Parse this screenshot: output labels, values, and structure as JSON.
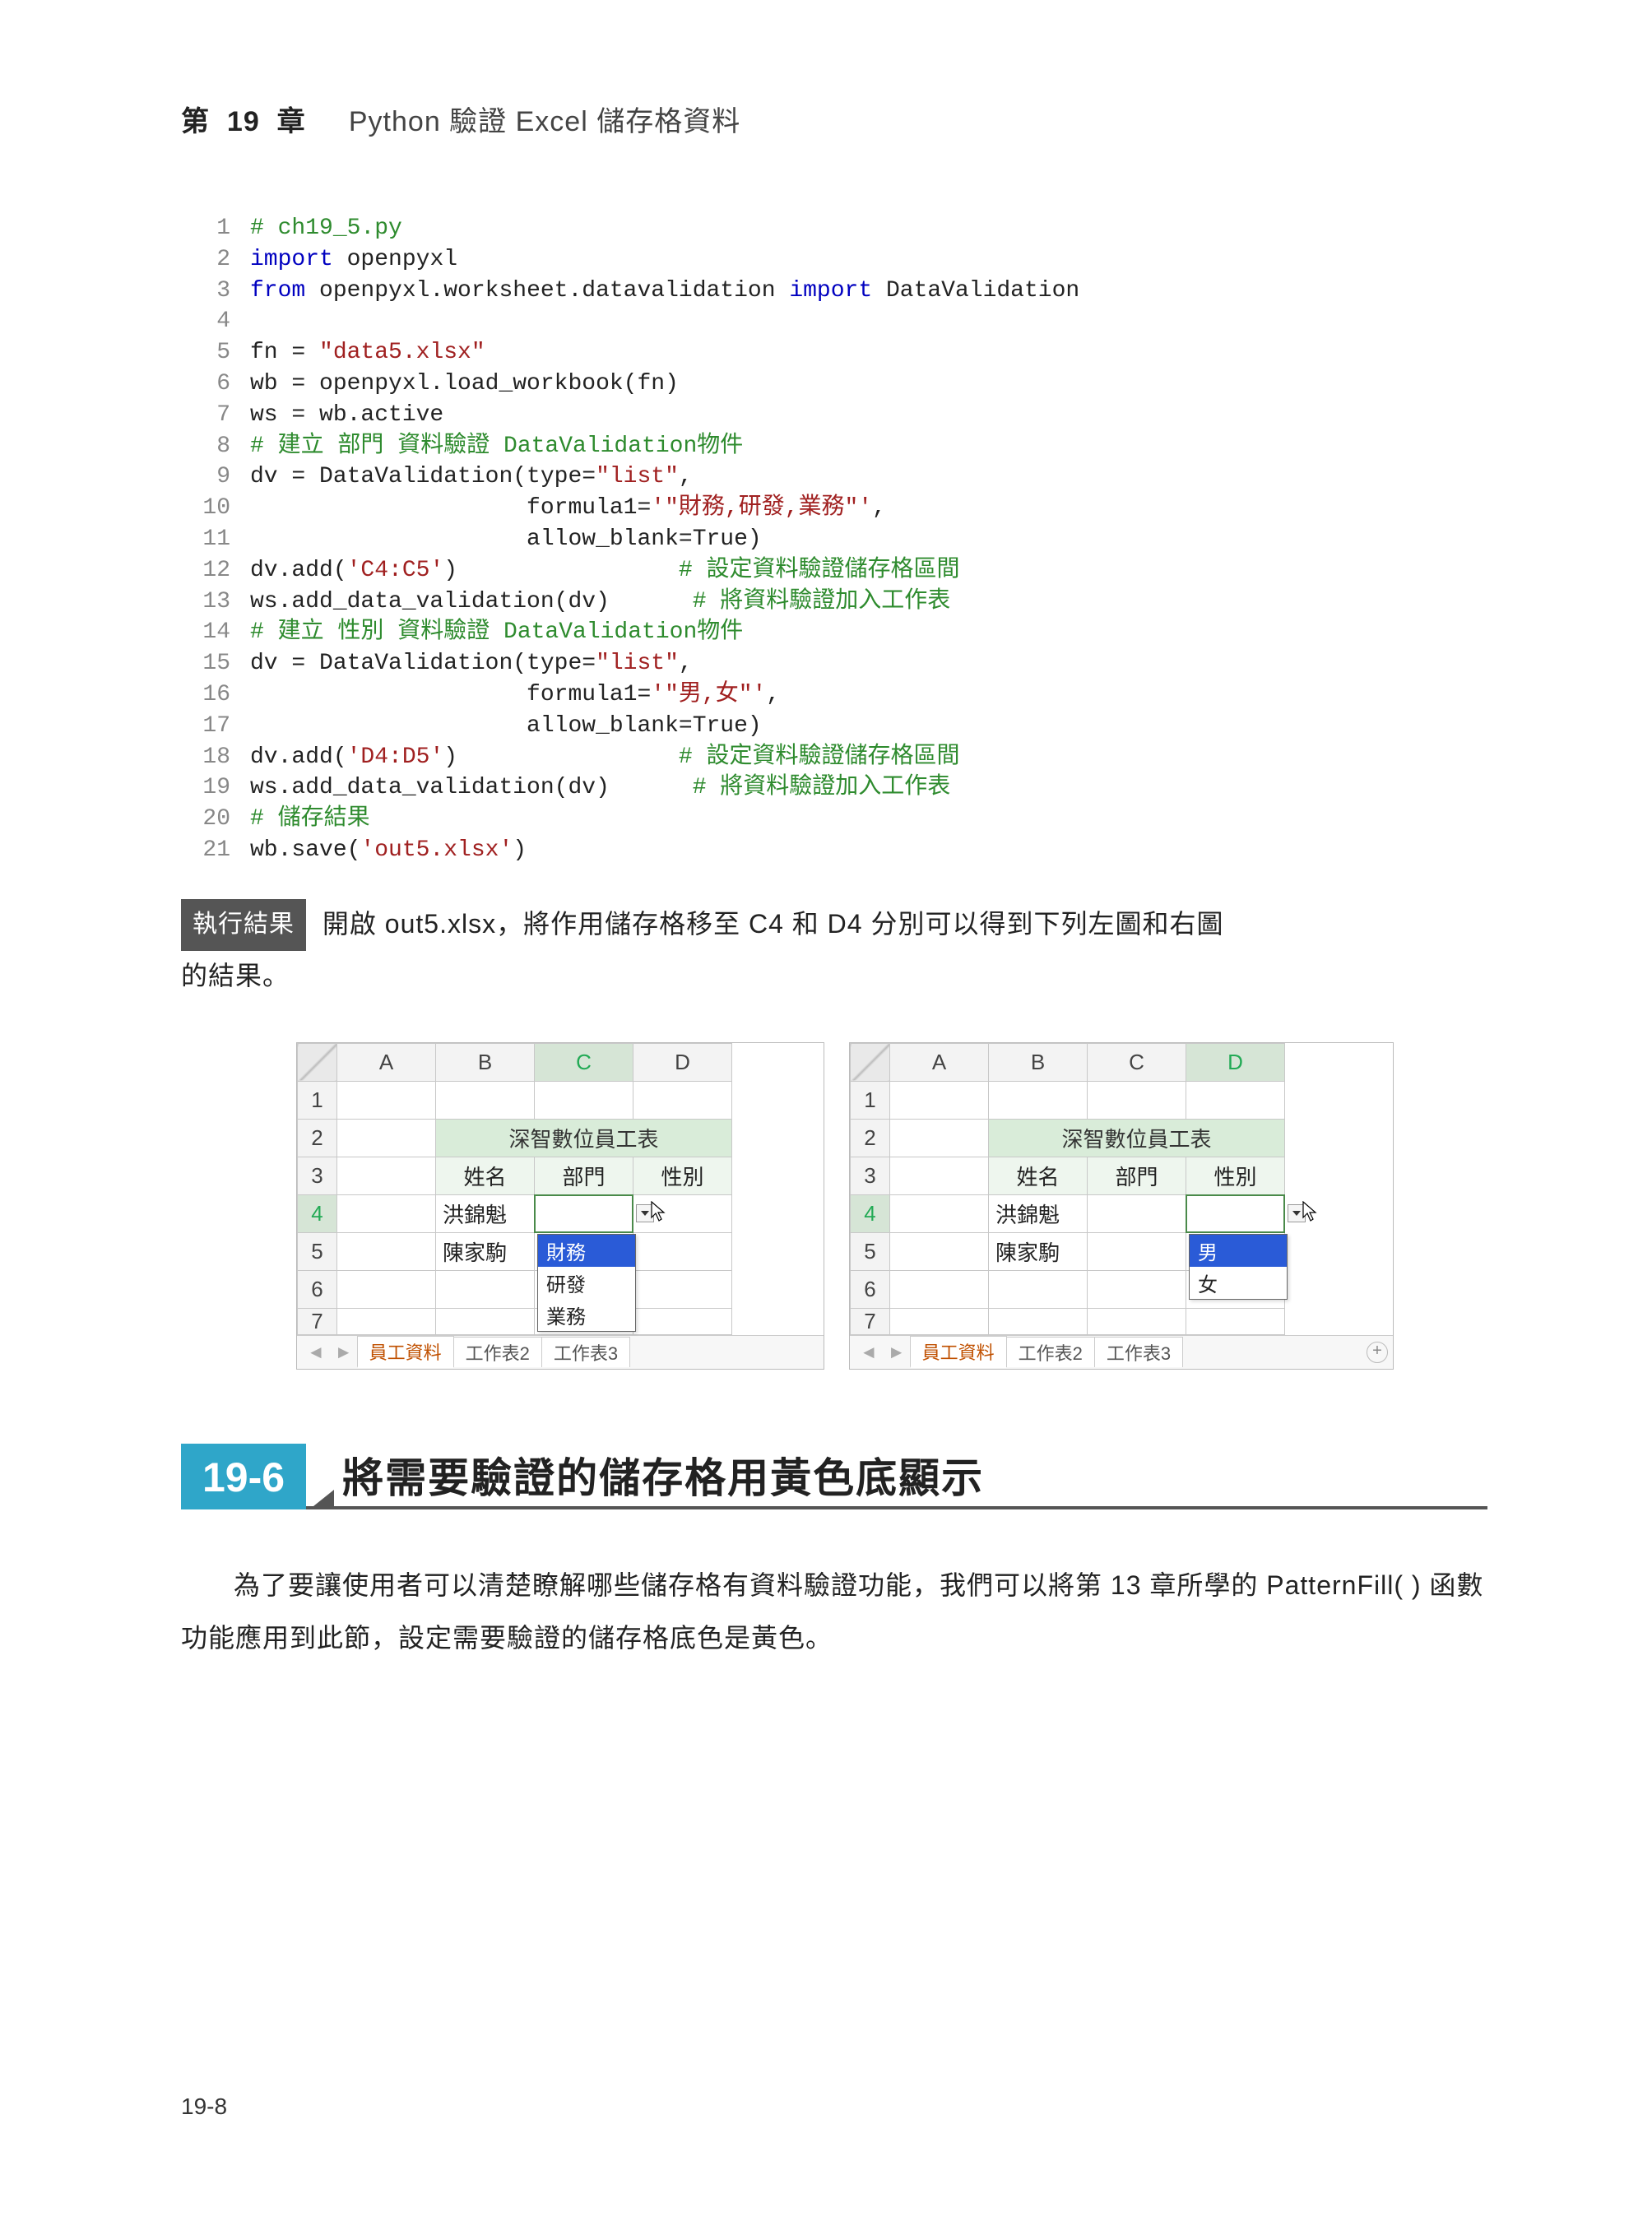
{
  "header": {
    "chapter_label": "第",
    "chapter_num": "19",
    "chapter_label2": "章",
    "title": "Python 驗證 Excel 儲存格資料"
  },
  "code": {
    "lines": [
      {
        "n": "1",
        "seg": [
          {
            "cls": "c-comment",
            "t": "# ch19_5.py"
          }
        ]
      },
      {
        "n": "2",
        "seg": [
          {
            "cls": "c-key",
            "t": "import"
          },
          {
            "cls": "",
            "t": " openpyxl"
          }
        ]
      },
      {
        "n": "3",
        "seg": [
          {
            "cls": "c-key",
            "t": "from"
          },
          {
            "cls": "",
            "t": " openpyxl.worksheet.datavalidation "
          },
          {
            "cls": "c-key",
            "t": "import"
          },
          {
            "cls": "",
            "t": " DataValidation"
          }
        ]
      },
      {
        "n": "4",
        "seg": [
          {
            "cls": "",
            "t": ""
          }
        ]
      },
      {
        "n": "5",
        "seg": [
          {
            "cls": "",
            "t": "fn = "
          },
          {
            "cls": "c-str",
            "t": "\"data5.xlsx\""
          }
        ]
      },
      {
        "n": "6",
        "seg": [
          {
            "cls": "",
            "t": "wb = openpyxl.load_workbook(fn)"
          }
        ]
      },
      {
        "n": "7",
        "seg": [
          {
            "cls": "",
            "t": "ws = wb.active"
          }
        ]
      },
      {
        "n": "8",
        "seg": [
          {
            "cls": "c-comment",
            "t": "# 建立 部門 資料驗證 DataValidation物件"
          }
        ]
      },
      {
        "n": "9",
        "seg": [
          {
            "cls": "",
            "t": "dv = DataValidation(type="
          },
          {
            "cls": "c-str",
            "t": "\"list\""
          },
          {
            "cls": "",
            "t": ","
          }
        ]
      },
      {
        "n": "10",
        "seg": [
          {
            "cls": "",
            "t": "                    formula1="
          },
          {
            "cls": "c-str",
            "t": "'\"財務,研發,業務\"'"
          },
          {
            "cls": "",
            "t": ","
          }
        ]
      },
      {
        "n": "11",
        "seg": [
          {
            "cls": "",
            "t": "                    allow_blank=True)"
          }
        ]
      },
      {
        "n": "12",
        "seg": [
          {
            "cls": "",
            "t": "dv.add("
          },
          {
            "cls": "c-str",
            "t": "'C4:C5'"
          },
          {
            "cls": "",
            "t": ")                "
          },
          {
            "cls": "c-comment",
            "t": "# 設定資料驗證儲存格區間"
          }
        ]
      },
      {
        "n": "13",
        "seg": [
          {
            "cls": "",
            "t": "ws.add_data_validation(dv)      "
          },
          {
            "cls": "c-comment",
            "t": "# 將資料驗證加入工作表"
          }
        ]
      },
      {
        "n": "14",
        "seg": [
          {
            "cls": "c-comment",
            "t": "# 建立 性別 資料驗證 DataValidation物件"
          }
        ]
      },
      {
        "n": "15",
        "seg": [
          {
            "cls": "",
            "t": "dv = DataValidation(type="
          },
          {
            "cls": "c-str",
            "t": "\"list\""
          },
          {
            "cls": "",
            "t": ","
          }
        ]
      },
      {
        "n": "16",
        "seg": [
          {
            "cls": "",
            "t": "                    formula1="
          },
          {
            "cls": "c-str",
            "t": "'\"男,女\"'"
          },
          {
            "cls": "",
            "t": ","
          }
        ]
      },
      {
        "n": "17",
        "seg": [
          {
            "cls": "",
            "t": "                    allow_blank=True)"
          }
        ]
      },
      {
        "n": "18",
        "seg": [
          {
            "cls": "",
            "t": "dv.add("
          },
          {
            "cls": "c-str",
            "t": "'D4:D5'"
          },
          {
            "cls": "",
            "t": ")                "
          },
          {
            "cls": "c-comment",
            "t": "# 設定資料驗證儲存格區間"
          }
        ]
      },
      {
        "n": "19",
        "seg": [
          {
            "cls": "",
            "t": "ws.add_data_validation(dv)      "
          },
          {
            "cls": "c-comment",
            "t": "# 將資料驗證加入工作表"
          }
        ]
      },
      {
        "n": "20",
        "seg": [
          {
            "cls": "c-comment",
            "t": "# 儲存結果"
          }
        ]
      },
      {
        "n": "21",
        "seg": [
          {
            "cls": "",
            "t": "wb.save("
          },
          {
            "cls": "c-str",
            "t": "'out5.xlsx'"
          },
          {
            "cls": "",
            "t": ")"
          }
        ]
      }
    ]
  },
  "result_tag": "執行結果",
  "result_text_a": "開啟 out5.xlsx，將作用儲存格移至 C4 和 D4 分別可以得到下列左圖和右圖",
  "result_text_b": "的結果。",
  "excel_common": {
    "cols": [
      "A",
      "B",
      "C",
      "D"
    ],
    "rows": [
      "1",
      "2",
      "3",
      "4",
      "5",
      "6",
      "7"
    ],
    "title": "深智數位員工表",
    "headers": [
      "姓名",
      "部門",
      "性別"
    ],
    "names": [
      "洪錦魁",
      "陳家駒"
    ],
    "tabs": [
      "員工資料",
      "工作表2",
      "工作表3"
    ]
  },
  "excel_left": {
    "selected_col": "C",
    "selected_row": "4",
    "dropdown": [
      "財務",
      "研發",
      "業務"
    ],
    "dropdown_sel_index": 0
  },
  "excel_right": {
    "selected_col": "D",
    "selected_row": "4",
    "dropdown": [
      "男",
      "女"
    ],
    "dropdown_sel_index": 0
  },
  "section": {
    "num": "19-6",
    "title": "將需要驗證的儲存格用黃色底顯示"
  },
  "body_para": "為了要讓使用者可以清楚瞭解哪些儲存格有資料驗證功能，我們可以將第 13 章所學的 PatternFill( ) 函數功能應用到此節，設定需要驗證的儲存格底色是黃色。",
  "page_num": "19-8"
}
